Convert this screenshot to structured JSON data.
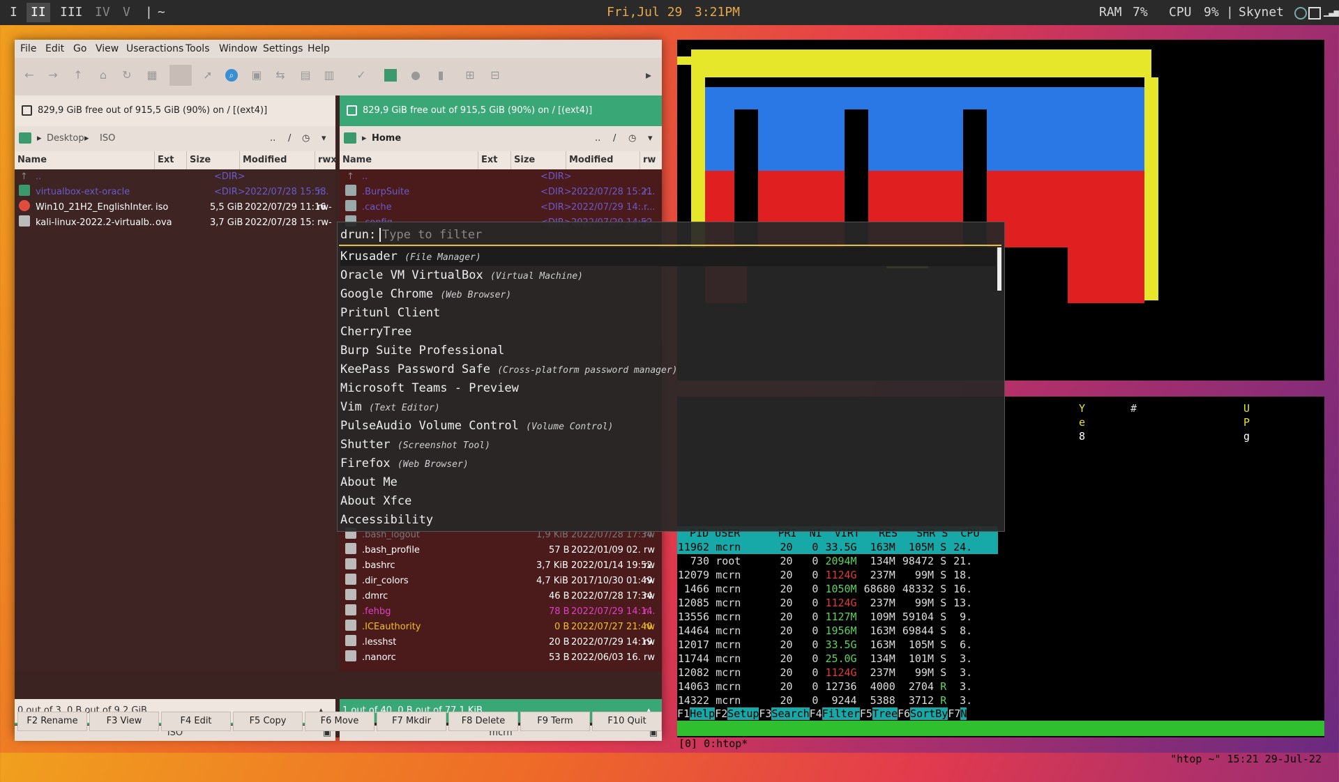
{
  "topbar": {
    "workspaces": [
      "I",
      "II",
      "III",
      "IV",
      "V"
    ],
    "active_workspace": "II",
    "separator": "|",
    "tilde": "~",
    "date": "Fri,Jul 29",
    "time": "3:21PM",
    "ram_label": "RAM",
    "ram_value": "7%",
    "cpu_label": "CPU",
    "cpu_value": "9%",
    "host": "Skynet"
  },
  "krusader": {
    "menu": [
      "File",
      "Edit",
      "Go",
      "View",
      "Useractions",
      "Tools",
      "Window",
      "Settings",
      "Help"
    ],
    "left": {
      "status": "829,9 GiB free out of 915,5 GiB (90%) on / [(ext4)]",
      "path": [
        "Desktop",
        "ISO"
      ],
      "path_tail": "..",
      "path_sep": "/",
      "headers": [
        "Name",
        "Ext",
        "Size",
        "Modified",
        "rwx"
      ],
      "rows": [
        {
          "name": "..",
          "ext": "",
          "size": "<DIR>",
          "mod": "",
          "perm": ""
        },
        {
          "name": "virtualbox-ext-oracle",
          "ext": "",
          "size": "<DIR>",
          "mod": "2022/07/28 15:58",
          "perm": "r..."
        },
        {
          "name": "Win10_21H2_EnglishInter...",
          "ext": "iso",
          "size": "5,5 GiB",
          "mod": "2022/07/29 11:16",
          "perm": "rw-"
        },
        {
          "name": "kali-linux-2022.2-virtualb...",
          "ext": "ova",
          "size": "3,7 GiB",
          "mod": "2022/07/28 15:...",
          "perm": "rw-"
        }
      ],
      "footer": "0 out of 3, 0 B out of 9,2 GiB",
      "dir_label": "ISO"
    },
    "right": {
      "status": "829,9 GiB free out of 915,5 GiB (90%) on / [(ext4)]",
      "path": [
        "Home"
      ],
      "path_tail": "..",
      "path_sep": "/",
      "headers": [
        "Name",
        "Ext",
        "Size",
        "Modified",
        "rw"
      ],
      "rows_top": [
        {
          "name": "..",
          "size": "<DIR>",
          "mod": "",
          "perm": ""
        },
        {
          "name": ".BurpSuite",
          "size": "<DIR>",
          "mod": "2022/07/28 15:21",
          "perm": "r..."
        },
        {
          "name": ".cache",
          "size": "<DIR>",
          "mod": "2022/07/29 14:...",
          "perm": "r..."
        },
        {
          "name": ".config",
          "size": "<DIR>",
          "mod": "2022/07/29 14:52",
          "perm": "r..."
        }
      ],
      "rows_bottom": [
        {
          "name": ".bash_logout",
          "size": "1,9 KiB",
          "mod": "2022/07/28 17:34",
          "perm": "rw"
        },
        {
          "name": ".bash_profile",
          "size": "57 B",
          "mod": "2022/01/09 02...",
          "perm": "rw"
        },
        {
          "name": ".bashrc",
          "size": "3,7 KiB",
          "mod": "2022/01/14 19:52",
          "perm": "rw"
        },
        {
          "name": ".dir_colors",
          "size": "4,7 KiB",
          "mod": "2017/10/30 01:49",
          "perm": "rw"
        },
        {
          "name": ".dmrc",
          "size": "46 B",
          "mod": "2022/07/28 17:34",
          "perm": "rw"
        },
        {
          "name": ".fehbg",
          "size": "78 B",
          "mod": "2022/07/29 14:14",
          "perm": "r..."
        },
        {
          "name": ".ICEauthority",
          "size": "0 B",
          "mod": "2022/07/27 21:40",
          "perm": "rw"
        },
        {
          "name": ".lesshst",
          "size": "20 B",
          "mod": "2022/07/29 14:19",
          "perm": "rw"
        },
        {
          "name": ".nanorc",
          "size": "53 B",
          "mod": "2022/06/03 16...",
          "perm": "rw"
        }
      ],
      "footer": "1 out of 40, 0 B out of 77,1 KiB",
      "dir_label": "mcrn"
    },
    "fkeys": [
      "F2 Rename",
      "F3 View",
      "F4 Edit",
      "F5 Copy",
      "F6 Move",
      "F7 Mkdir",
      "F8 Delete",
      "F9 Term",
      "F10 Quit"
    ]
  },
  "rofi": {
    "prompt": "drun:",
    "placeholder": "Type to filter",
    "items": [
      {
        "name": "Krusader",
        "desc": "(File Manager)"
      },
      {
        "name": "Oracle VM VirtualBox",
        "desc": "(Virtual Machine)"
      },
      {
        "name": "Google Chrome",
        "desc": "(Web Browser)"
      },
      {
        "name": "Pritunl Client",
        "desc": ""
      },
      {
        "name": "CherryTree",
        "desc": ""
      },
      {
        "name": "Burp Suite Professional",
        "desc": ""
      },
      {
        "name": "KeePass Password Safe",
        "desc": "(Cross-platform password manager)"
      },
      {
        "name": "Microsoft Teams - Preview",
        "desc": ""
      },
      {
        "name": "Vim",
        "desc": "(Text Editor)"
      },
      {
        "name": "PulseAudio Volume Control",
        "desc": "(Volume Control)"
      },
      {
        "name": "Shutter",
        "desc": "(Screenshot Tool)"
      },
      {
        "name": "Firefox",
        "desc": "(Web Browser)"
      },
      {
        "name": "About Me",
        "desc": ""
      },
      {
        "name": "About Xfce",
        "desc": ""
      },
      {
        "name": "Accessibility",
        "desc": ""
      }
    ]
  },
  "terminal": {
    "chars": [
      "Y",
      "#",
      "U",
      "e",
      "P",
      "8",
      "g"
    ]
  },
  "htop": {
    "header": "  PID USER      PRI  NI  VIRT   RES   SHR S  CPU",
    "rows": [
      {
        "pid": "11962",
        "user": "mcrn",
        "pri": "20",
        "ni": "0",
        "virt": "33.5G",
        "res": "163M",
        "shr": "105M",
        "s": "S",
        "cpu": "24."
      },
      {
        "pid": "730",
        "user": "root",
        "pri": "20",
        "ni": "0",
        "virt": "2094M",
        "res": "134M",
        "shr": "98472",
        "s": "S",
        "cpu": "21."
      },
      {
        "pid": "12079",
        "user": "mcrn",
        "pri": "20",
        "ni": "0",
        "virt": "1124G",
        "res": "237M",
        "shr": "99M",
        "s": "S",
        "cpu": "18."
      },
      {
        "pid": "1466",
        "user": "mcrn",
        "pri": "20",
        "ni": "0",
        "virt": "1050M",
        "res": "68680",
        "shr": "48332",
        "s": "S",
        "cpu": "16."
      },
      {
        "pid": "12085",
        "user": "mcrn",
        "pri": "20",
        "ni": "0",
        "virt": "1124G",
        "res": "237M",
        "shr": "99M",
        "s": "S",
        "cpu": "13."
      },
      {
        "pid": "13556",
        "user": "mcrn",
        "pri": "20",
        "ni": "0",
        "virt": "1127M",
        "res": "109M",
        "shr": "59104",
        "s": "S",
        "cpu": "9."
      },
      {
        "pid": "14464",
        "user": "mcrn",
        "pri": "20",
        "ni": "0",
        "virt": "1956M",
        "res": "163M",
        "shr": "69844",
        "s": "S",
        "cpu": "8."
      },
      {
        "pid": "12017",
        "user": "mcrn",
        "pri": "20",
        "ni": "0",
        "virt": "33.5G",
        "res": "163M",
        "shr": "105M",
        "s": "S",
        "cpu": "6."
      },
      {
        "pid": "11744",
        "user": "mcrn",
        "pri": "20",
        "ni": "0",
        "virt": "25.0G",
        "res": "134M",
        "shr": "101M",
        "s": "S",
        "cpu": "3."
      },
      {
        "pid": "12082",
        "user": "mcrn",
        "pri": "20",
        "ni": "0",
        "virt": "1124G",
        "res": "237M",
        "shr": "99M",
        "s": "S",
        "cpu": "3."
      },
      {
        "pid": "14063",
        "user": "mcrn",
        "pri": "20",
        "ni": "0",
        "virt": "12736",
        "res": "4000",
        "shr": "2704",
        "s": "R",
        "cpu": "3."
      },
      {
        "pid": "14322",
        "user": "mcrn",
        "pri": "20",
        "ni": "0",
        "virt": "9244",
        "res": "5388",
        "shr": "3712",
        "s": "R",
        "cpu": "3."
      }
    ],
    "fkeys": [
      {
        "k": "F1",
        "l": "Help"
      },
      {
        "k": "F2",
        "l": "Setup"
      },
      {
        "k": "F3",
        "l": "Search"
      },
      {
        "k": "F4",
        "l": "Filter"
      },
      {
        "k": "F5",
        "l": "Tree"
      },
      {
        "k": "F6",
        "l": "SortBy"
      },
      {
        "k": "F7",
        "l": "N"
      }
    ],
    "tmux_left": "[0] 0:htop*",
    "tmux_right": "\"htop ~\" 15:21 29-Jul-22"
  }
}
